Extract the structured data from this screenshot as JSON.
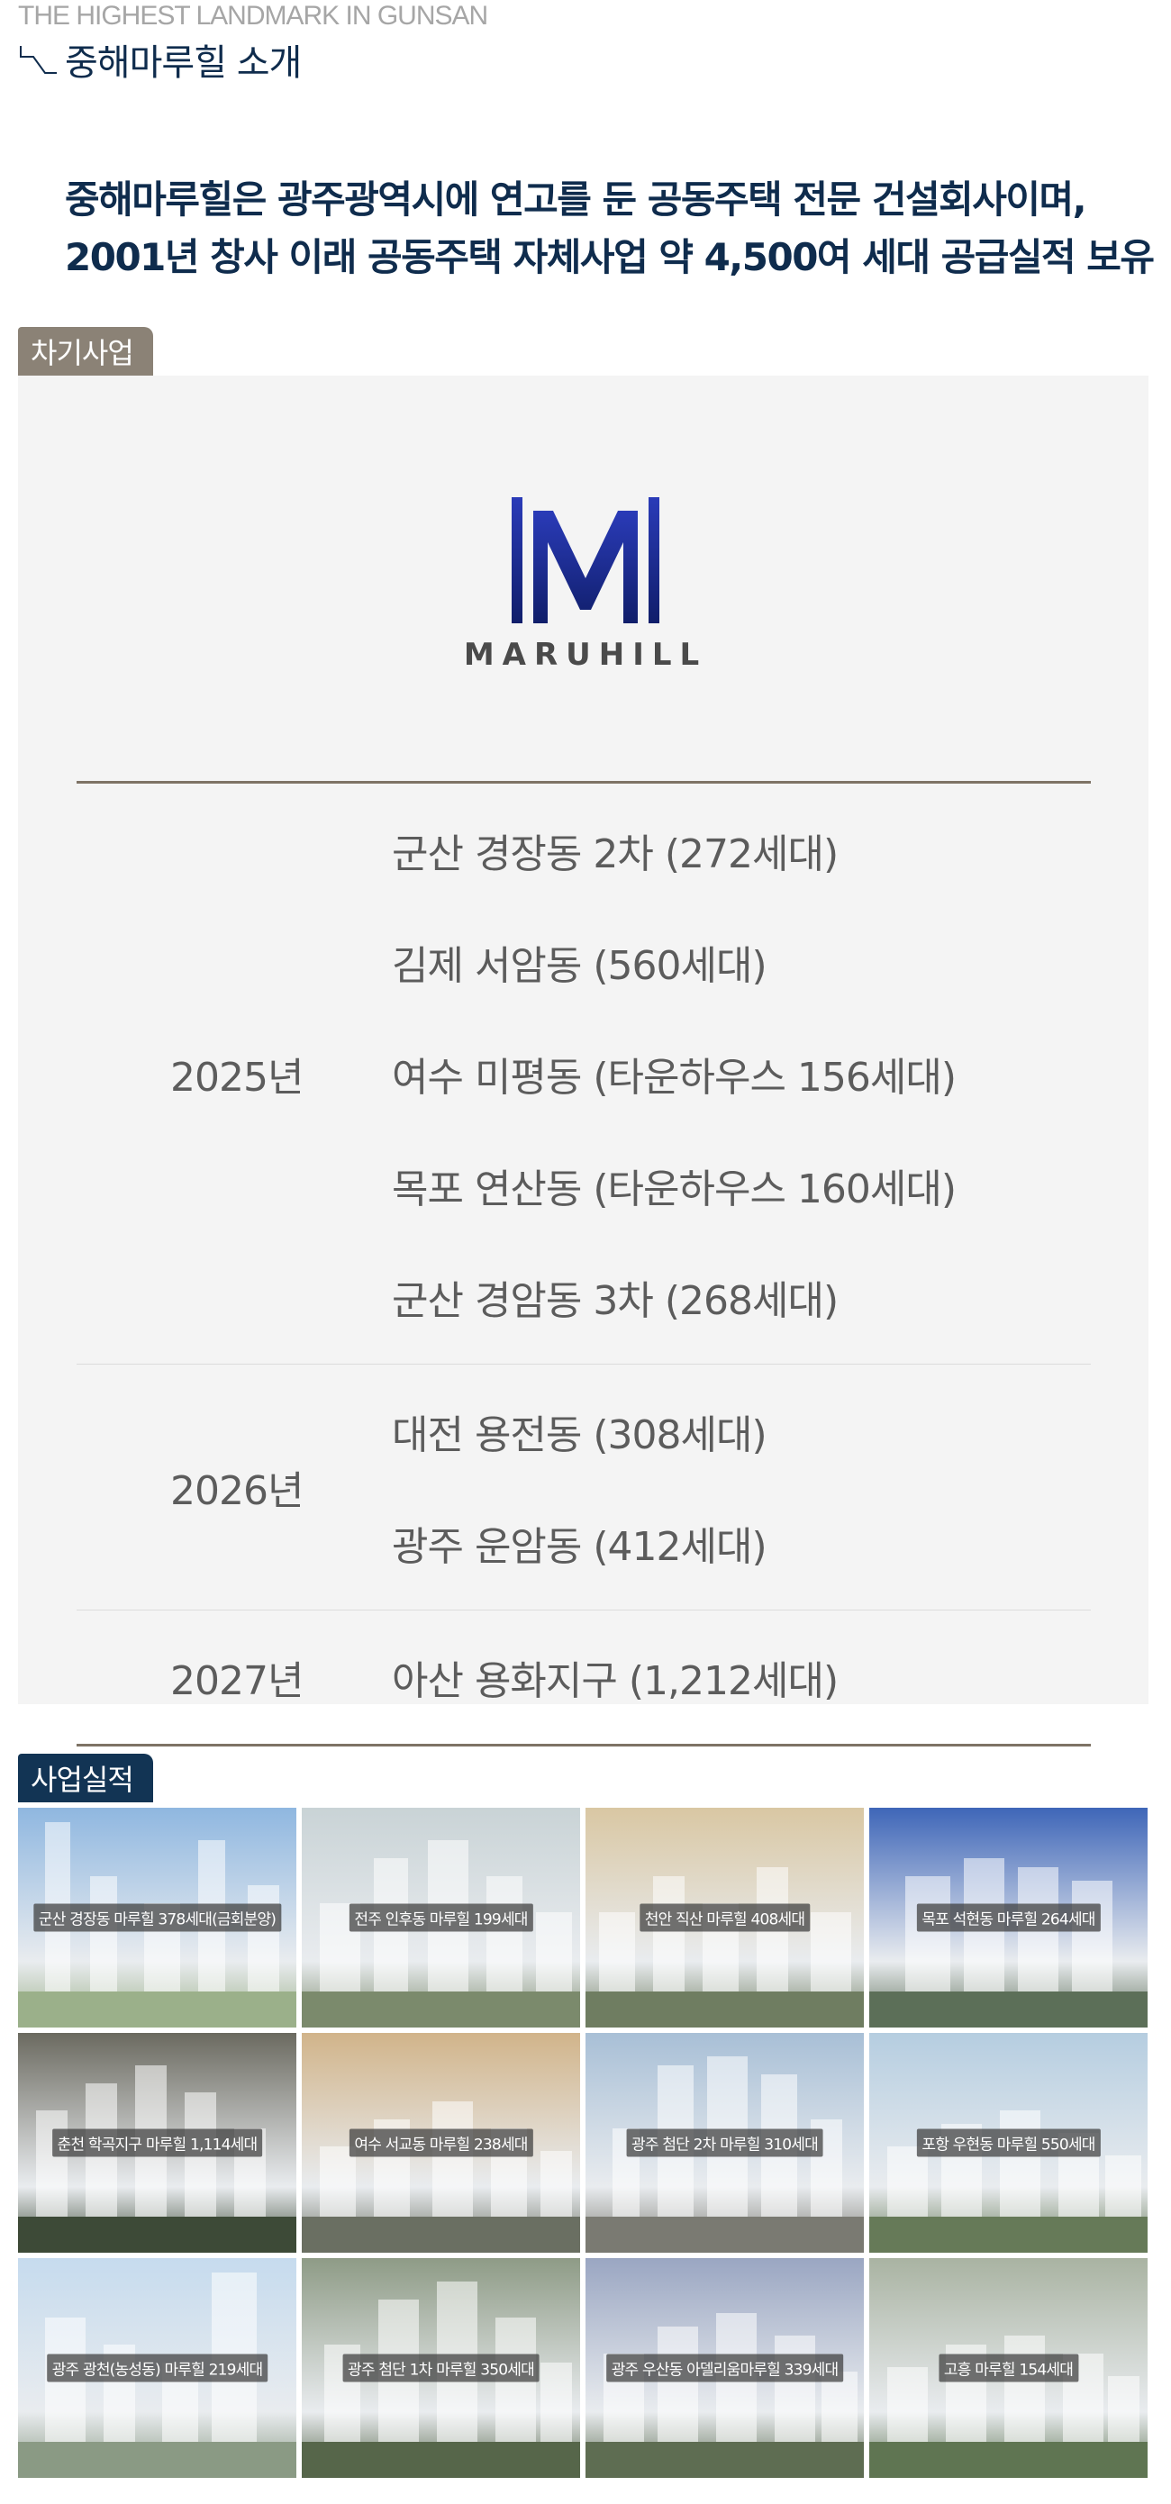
{
  "header": {
    "eyebrow": "THE HIGHEST LANDMARK IN GUNSAN",
    "title": "중해마루힐 소개"
  },
  "intro": {
    "line1": "중해마루힐은 광주광역시에 연고를 둔 공동주택 전문 건설회사이며,",
    "line2": "2001년 창사 이래 공동주택 자체사업 약 4,500여 세대 공급실적 보유"
  },
  "next_projects": {
    "tag": "차기사업",
    "logo_text": "MARUHILL",
    "schedule": [
      {
        "year": "2025년",
        "items": [
          "군산 경장동 2차 (272세대)",
          "김제 서암동 (560세대)",
          "여수 미평동 (타운하우스 156세대)",
          "목포 연산동 (타운하우스 160세대)",
          "군산 경암동 3차 (268세대)"
        ]
      },
      {
        "year": "2026년",
        "items": [
          "대전 용전동 (308세대)",
          "광주 운암동 (412세대)"
        ]
      },
      {
        "year": "2027년",
        "items": [
          "아산 용화지구 (1,212세대)"
        ]
      }
    ]
  },
  "track_record": {
    "tag": "사업실적",
    "projects": [
      {
        "caption": "군산 경장동 마루힐 378세대(금회분양)",
        "sky": "#8fb7e0",
        "ground": "#9bb08a"
      },
      {
        "caption": "전주 인후동 마루힐 199세대",
        "sky": "#c9d3d6",
        "ground": "#7b8a6c"
      },
      {
        "caption": "천안 직산 마루힐 408세대",
        "sky": "#d9c7a3",
        "ground": "#6f7d61"
      },
      {
        "caption": "목포 석현동 마루힐 264세대",
        "sky": "#3e66b8",
        "ground": "#5c6f58"
      },
      {
        "caption": "춘천 학곡지구 마루힐 1,114세대",
        "sky": "#6b6a60",
        "ground": "#3d4a37"
      },
      {
        "caption": "여수 서교동 마루힐 238세대",
        "sky": "#d1b48a",
        "ground": "#6a6f62"
      },
      {
        "caption": "광주 첨단 2차 마루힐 310세대",
        "sky": "#a8bfd6",
        "ground": "#7a7a72"
      },
      {
        "caption": "포항 우현동 마루힐 550세대",
        "sky": "#b5cde0",
        "ground": "#667a58"
      },
      {
        "caption": "광주 광천(농성동) 마루힐 219세대",
        "sky": "#c6dbee",
        "ground": "#8a9a84"
      },
      {
        "caption": "광주 첨단 1차 마루힐 350세대",
        "sky": "#8e9b86",
        "ground": "#56664a"
      },
      {
        "caption": "광주 우산동 아델리움마루힐 339세대",
        "sky": "#9aa6c2",
        "ground": "#5e6d52"
      },
      {
        "caption": "고흥 마루힐 154세대",
        "sky": "#a9b3a2",
        "ground": "#5f7552"
      }
    ]
  }
}
